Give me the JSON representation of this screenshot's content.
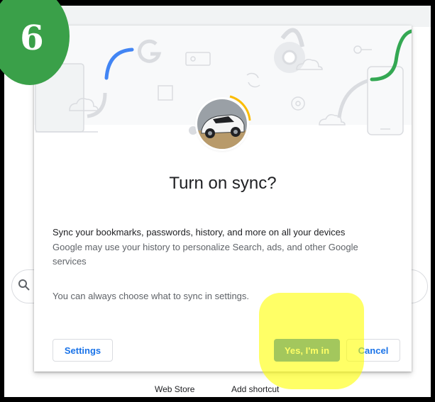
{
  "step_badge": "6",
  "dialog": {
    "title": "Turn on sync?",
    "body_primary": "Sync your bookmarks, passwords, history, and more on all your devices",
    "body_secondary": "Google may use your history to personalize Search, ads, and other Google services",
    "body_note": "You can always choose what to sync in settings.",
    "buttons": {
      "settings": "Settings",
      "confirm": "Yes, I'm in",
      "cancel": "Cancel"
    }
  },
  "bottom_links": {
    "web_store": "Web Store",
    "add_shortcut": "Add shortcut"
  },
  "colors": {
    "accent_blue": "#1a73e8",
    "google_blue": "#4285f4",
    "google_green": "#34a853",
    "badge_green": "#3aa049",
    "highlight_yellow": "#ffff00"
  }
}
